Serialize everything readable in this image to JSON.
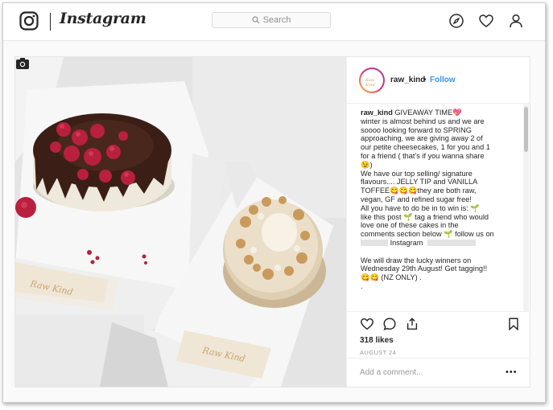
{
  "app": {
    "wordmark": "Instagram"
  },
  "search": {
    "placeholder": "Search"
  },
  "nav_icons": [
    "compass-icon",
    "heart-icon",
    "profile-icon"
  ],
  "post": {
    "author": "raw_kind",
    "separator": "•",
    "follow_label": "Follow",
    "avatar_text": "Raw Kind",
    "caption_lines": [
      "winter is almost behind us and we are",
      "soooo looking forward to SPRING",
      "approaching, we are giving away 2 of",
      "our petite cheesecakes, 1 for you and 1",
      "for a friend ( that’s if you wanna share",
      "😉)",
      "We have our top selling/ signature",
      "flavours.... JELLY TIP and VANILLA",
      "TOFFEE😋😋😋they are both raw,",
      "vegan, GF and refined sugar free!",
      "All you have to do be in to win is: 🌱",
      "like this post 🌱 tag a friend who would",
      "love one of these cakes in the",
      "comments section below 🌱 follow us on"
    ],
    "caption_title": "GIVEAWAY TIME💖",
    "caption_instagram": "Instagram",
    "caption_after": [
      "We will draw the lucky winners on",
      "Wednesday 29th August! Get tagging!!",
      "😋😋 (NZ ONLY) .",
      "."
    ],
    "likes": "318 likes",
    "date": "AUGUST 24",
    "comment_placeholder": "Add a comment...",
    "more_label": "•••",
    "box_brand": "Raw Kind"
  },
  "colors": {
    "link": "#3897f0",
    "chocolate": "#3b1f17",
    "raspberry": "#b8203e"
  }
}
